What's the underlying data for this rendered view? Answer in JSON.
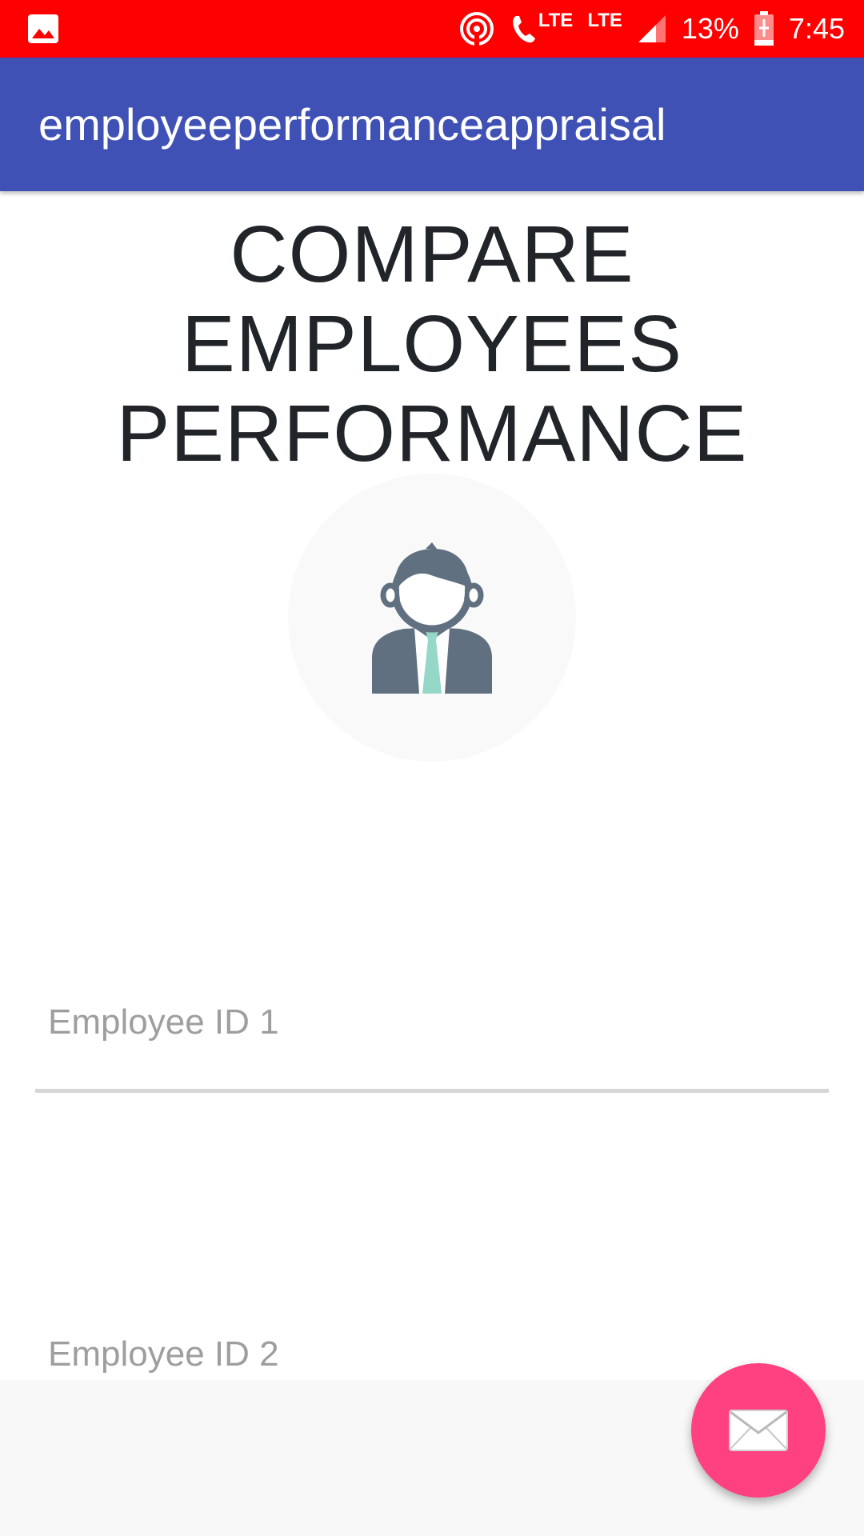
{
  "status_bar": {
    "battery": "13%",
    "time": "7:45",
    "network1": "LTE",
    "network2": "LTE",
    "icons": [
      "gallery-icon",
      "hotspot-icon",
      "call-icon",
      "signal-icon",
      "battery-charging-icon"
    ],
    "background_color": "#ff0000"
  },
  "app_bar": {
    "title": "employeeperformanceappraisal",
    "color": "#3f51b5"
  },
  "heading": {
    "line1": "COMPARE",
    "line2": "EMPLOYEES",
    "line3": "PERFORMANCE"
  },
  "avatar": {
    "icon": "employee-avatar-icon"
  },
  "form": {
    "employee1": {
      "placeholder": "Employee ID 1",
      "value": ""
    },
    "employee2": {
      "placeholder": "Employee ID 2",
      "value": ""
    }
  },
  "fab": {
    "icon": "mail-icon",
    "color": "#ff4081"
  }
}
